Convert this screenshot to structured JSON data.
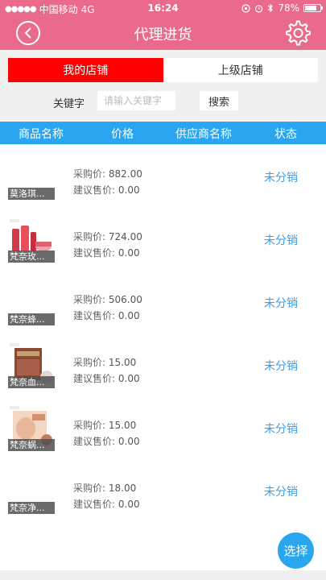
{
  "status_bar": {
    "carrier": "中国移动",
    "network": "4G",
    "time": "16:24",
    "battery": "78%",
    "battery_level": 0.78
  },
  "nav": {
    "title": "代理进货",
    "back_icon": "chevron-left-icon",
    "settings_icon": "gear-icon"
  },
  "tabs": [
    {
      "label": "我的店铺",
      "active": true
    },
    {
      "label": "上级店铺",
      "active": false
    }
  ],
  "search": {
    "label": "关键字",
    "placeholder": "请输入关键字",
    "value": "",
    "button": "搜索"
  },
  "table_header": [
    "商品名称",
    "价格",
    "供应商名称",
    "状态"
  ],
  "purchase_label": "采购价:",
  "suggest_label": "建议售价:",
  "items": [
    {
      "name": "莫洛琪...",
      "purchase_price": "882.00",
      "suggest_price": "0.00",
      "status": "未分销"
    },
    {
      "name": "梵奈玫...",
      "purchase_price": "724.00",
      "suggest_price": "0.00",
      "status": "未分销"
    },
    {
      "name": "梵奈蜂...",
      "purchase_price": "506.00",
      "suggest_price": "0.00",
      "status": "未分销"
    },
    {
      "name": "梵奈血...",
      "purchase_price": "15.00",
      "suggest_price": "0.00",
      "status": "未分销"
    },
    {
      "name": "梵奈蜗...",
      "purchase_price": "15.00",
      "suggest_price": "0.00",
      "status": "未分销"
    },
    {
      "name": "梵奈净...",
      "purchase_price": "18.00",
      "suggest_price": "0.00",
      "status": "未分销"
    }
  ],
  "fab_label": "选择",
  "colors": {
    "primary_pink": "#e96a8b",
    "active_tab": "#ff0000",
    "header_blue": "#2aa6f0",
    "status_blue": "#3a9ee8"
  }
}
